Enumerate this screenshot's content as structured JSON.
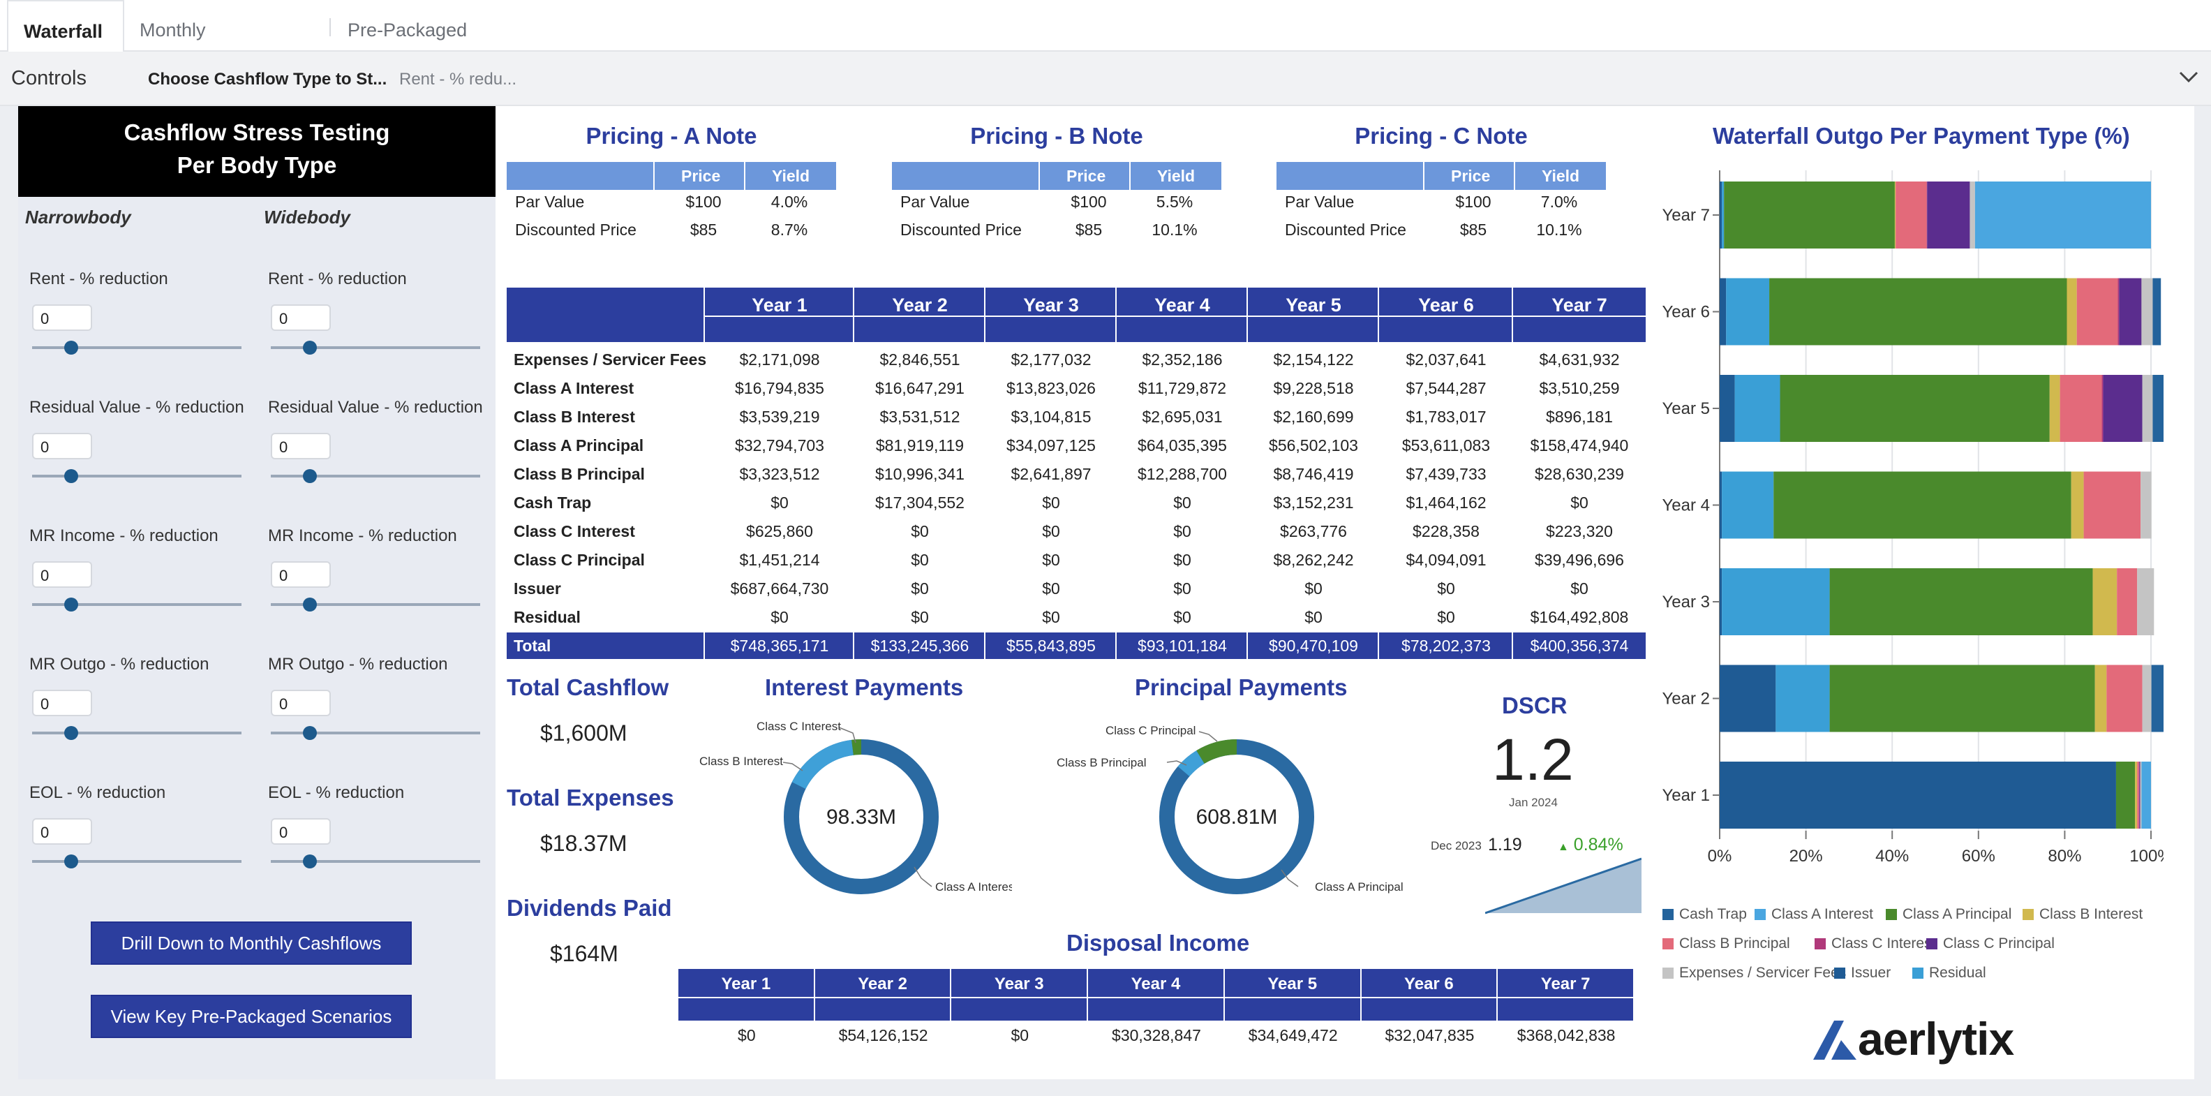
{
  "tabs": [
    "Waterfall",
    "Monthly Breakdown",
    "Pre-Packaged Scenarios"
  ],
  "controls": {
    "label": "Controls",
    "choose": "Choose Cashflow Type to St...",
    "value": "Rent - % redu..."
  },
  "left": {
    "title_line1": "Cashflow Stress Testing",
    "title_line2": "Per Body Type",
    "col1": "Narrowbody",
    "col2": "Widebody",
    "params": [
      {
        "label": "Rent - % reduction",
        "nb": "0",
        "wb": "0"
      },
      {
        "label": "Residual Value - % reduction",
        "nb": "0",
        "wb": "0"
      },
      {
        "label": "MR Income - % reduction",
        "nb": "0",
        "wb": "0"
      },
      {
        "label": "MR Outgo - % reduction",
        "nb": "0",
        "wb": "0"
      },
      {
        "label": "EOL - % reduction",
        "nb": "0",
        "wb": "0"
      }
    ],
    "btn_drill": "Drill Down to Monthly Cashflows",
    "btn_view": "View Key Pre-Packaged Scenarios"
  },
  "pricing": [
    {
      "title": "Pricing - A Note",
      "h_price": "Price",
      "h_yield": "Yield",
      "rows": [
        {
          "label": "Par Value",
          "price": "$100",
          "yield": "4.0%"
        },
        {
          "label": "Discounted Price",
          "price": "$85",
          "yield": "8.7%"
        }
      ]
    },
    {
      "title": "Pricing - B Note",
      "h_price": "Price",
      "h_yield": "Yield",
      "rows": [
        {
          "label": "Par Value",
          "price": "$100",
          "yield": "5.5%"
        },
        {
          "label": "Discounted Price",
          "price": "$85",
          "yield": "10.1%"
        }
      ]
    },
    {
      "title": "Pricing - C Note",
      "h_price": "Price",
      "h_yield": "Yield",
      "rows": [
        {
          "label": "Par Value",
          "price": "$100",
          "yield": "7.0%"
        },
        {
          "label": "Discounted Price",
          "price": "$85",
          "yield": "10.1%"
        }
      ]
    }
  ],
  "waterfall_table": {
    "years": [
      "Year 1",
      "Year 2",
      "Year 3",
      "Year 4",
      "Year 5",
      "Year 6",
      "Year 7"
    ],
    "rows": [
      {
        "label": "Expenses / Servicer Fees",
        "values": [
          "$2,171,098",
          "$2,846,551",
          "$2,177,032",
          "$2,352,186",
          "$2,154,122",
          "$2,037,641",
          "$4,631,932"
        ]
      },
      {
        "label": "Class A Interest",
        "values": [
          "$16,794,835",
          "$16,647,291",
          "$13,823,026",
          "$11,729,872",
          "$9,228,518",
          "$7,544,287",
          "$3,510,259"
        ]
      },
      {
        "label": "Class B Interest",
        "values": [
          "$3,539,219",
          "$3,531,512",
          "$3,104,815",
          "$2,695,031",
          "$2,160,699",
          "$1,783,017",
          "$896,181"
        ]
      },
      {
        "label": "Class A Principal",
        "values": [
          "$32,794,703",
          "$81,919,119",
          "$34,097,125",
          "$64,035,395",
          "$56,502,103",
          "$53,611,083",
          "$158,474,940"
        ]
      },
      {
        "label": "Class B Principal",
        "values": [
          "$3,323,512",
          "$10,996,341",
          "$2,641,897",
          "$12,288,700",
          "$8,746,419",
          "$7,439,733",
          "$28,630,239"
        ]
      },
      {
        "label": "Cash Trap",
        "values": [
          "$0",
          "$17,304,552",
          "$0",
          "$0",
          "$3,152,231",
          "$1,464,162",
          "$0"
        ]
      },
      {
        "label": "Class C Interest",
        "values": [
          "$625,860",
          "$0",
          "$0",
          "$0",
          "$263,776",
          "$228,358",
          "$223,320"
        ]
      },
      {
        "label": "Class C Principal",
        "values": [
          "$1,451,214",
          "$0",
          "$0",
          "$0",
          "$8,262,242",
          "$4,094,091",
          "$39,496,696"
        ]
      },
      {
        "label": "Issuer",
        "values": [
          "$687,664,730",
          "$0",
          "$0",
          "$0",
          "$0",
          "$0",
          "$0"
        ]
      },
      {
        "label": "Residual",
        "values": [
          "$0",
          "$0",
          "$0",
          "$0",
          "$0",
          "$0",
          "$164,492,808"
        ]
      }
    ],
    "total": {
      "label": "Total",
      "values": [
        "$748,365,171",
        "$133,245,366",
        "$55,843,895",
        "$93,101,184",
        "$90,470,109",
        "$78,202,373",
        "$400,356,374"
      ]
    }
  },
  "kpis": {
    "total_cashflow_label": "Total Cashflow",
    "total_cashflow": "$1,600M",
    "total_expenses_label": "Total Expenses",
    "total_expenses": "$18.37M",
    "dividends_label": "Dividends Paid",
    "dividends": "$164M"
  },
  "interest_donut": {
    "title": "Interest Payments",
    "center": "98.33M",
    "labels": [
      "Class A Interest",
      "Class B Interest",
      "Class C Interest"
    ]
  },
  "principal_donut": {
    "title": "Principal Payments",
    "center": "608.81M",
    "labels": [
      "Class A Principal",
      "Class B Principal",
      "Class C Principal"
    ]
  },
  "dscr": {
    "title": "DSCR",
    "value": "1.2",
    "period": "Jan 2024",
    "prev_label": "Dec 2023",
    "prev_value": "1.19",
    "change": "0.84%",
    "change_arrow": "▲"
  },
  "disposal": {
    "title": "Disposal Income",
    "years": [
      "Year 1",
      "Year 2",
      "Year 3",
      "Year 4",
      "Year 5",
      "Year 6",
      "Year 7"
    ],
    "values": [
      "$0",
      "$54,126,152",
      "$0",
      "$30,328,847",
      "$34,649,472",
      "$32,047,835",
      "$368,042,838"
    ]
  },
  "logo": "aerlytix",
  "chart_data": {
    "type": "bar",
    "orientation": "horizontal",
    "stacked": "percent",
    "title": "Waterfall Outgo Per Payment Type (%)",
    "categories": [
      "Year 7",
      "Year 6",
      "Year 5",
      "Year 4",
      "Year 3",
      "Year 2",
      "Year 1"
    ],
    "xlim": [
      0,
      100
    ],
    "x_ticks": [
      "0%",
      "20%",
      "40%",
      "60%",
      "80%",
      "100%"
    ],
    "legend_position": "bottom",
    "series": [
      {
        "name": "Issuer",
        "color": "#1f5b94",
        "values": [
          0.5,
          1.5,
          3.5,
          0.5,
          0.5,
          13.0,
          91.9
        ]
      },
      {
        "name": "Residual",
        "color": "#3a9fd6",
        "values": [
          0.5,
          10.0,
          10.5,
          12.0,
          25.0,
          12.5,
          0.0
        ]
      },
      {
        "name": "Class A Principal",
        "color": "#4a8a2c",
        "values": [
          39.6,
          69.0,
          62.5,
          69.0,
          61.0,
          61.5,
          4.4
        ]
      },
      {
        "name": "Class B Interest",
        "color": "#d1b94e",
        "values": [
          0.2,
          2.3,
          2.4,
          2.9,
          5.6,
          2.7,
          0.5
        ]
      },
      {
        "name": "Class B Principal",
        "color": "#e36a7a",
        "values": [
          7.2,
          9.5,
          9.7,
          13.2,
          4.7,
          8.3,
          0.4
        ]
      },
      {
        "name": "Class C Interest",
        "color": "#b0397a",
        "values": [
          0.1,
          0.3,
          0.3,
          0.0,
          0.0,
          0.0,
          0.1
        ]
      },
      {
        "name": "Class C Principal",
        "color": "#5b2d8e",
        "values": [
          9.9,
          5.2,
          9.1,
          0.0,
          0.0,
          0.0,
          0.2
        ]
      },
      {
        "name": "Expenses / Servicer Fees",
        "color": "#c4c4c4",
        "values": [
          1.2,
          2.6,
          2.4,
          2.5,
          3.9,
          2.1,
          0.3
        ]
      },
      {
        "name": "Cash Trap",
        "color": "#23639c",
        "values": [
          0.0,
          1.9,
          3.5,
          0.0,
          0.0,
          13.0,
          0.0
        ]
      },
      {
        "name": "Class A Interest",
        "color": "#4aa6e0",
        "values": [
          40.8,
          0.0,
          0.0,
          0.0,
          0.0,
          0.0,
          2.2
        ]
      }
    ],
    "legend": [
      "Cash Trap",
      "Class A Interest",
      "Class A Principal",
      "Class B Interest",
      "Class B Principal",
      "Class C Interest",
      "Class C Principal",
      "Expenses / Servicer Fees",
      "Issuer",
      "Residual"
    ]
  }
}
